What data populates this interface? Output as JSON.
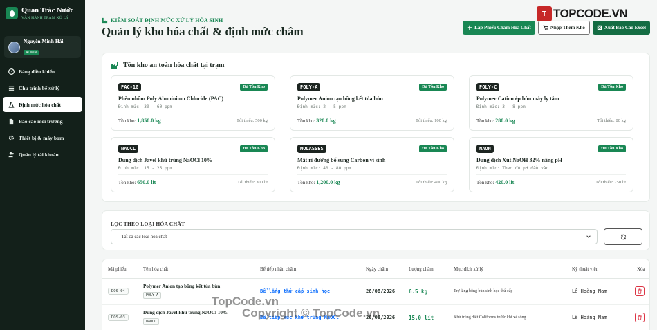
{
  "brand": {
    "title": "Quan Trắc Nước",
    "subtitle": "VẬN HÀNH TRẠM XỬ LÝ"
  },
  "user": {
    "name": "Nguyễn Minh Hải",
    "role": "ADMIN"
  },
  "nav": [
    {
      "label": "Bảng điều khiển",
      "icon": "gauge-icon"
    },
    {
      "label": "Chu trình bể xử lý",
      "icon": "list-icon"
    },
    {
      "label": "Định mức hóa chất",
      "icon": "flask-icon"
    },
    {
      "label": "Báo cáo môi trường",
      "icon": "document-icon"
    },
    {
      "label": "Thiết bị & máy bơm",
      "icon": "gear-icon"
    },
    {
      "label": "Quản lý tài khoản",
      "icon": "users-icon"
    }
  ],
  "header": {
    "eyebrow": "KIỂM SOÁT ĐỊNH MỨC XỬ LÝ HÓA SINH",
    "title": "Quản lý kho hóa chất & định mức châm",
    "actions": {
      "create": "Lập Phiếu Châm Hóa Chất",
      "import": "Nhập Thêm Kho",
      "export": "Xuất Báo Cáo Excel"
    }
  },
  "stock": {
    "title": "Tồn kho an toàn hóa chất tại trạm",
    "stock_label": "Tồn kho:",
    "min_label": "Tối thiểu:",
    "cards": [
      {
        "code": "PAC-10",
        "status": "Đủ Tồn Kho",
        "name": "Phèn nhôm Poly Aluminium Chloride (PAC)",
        "norm": "Định mức: 30 - 60 ppm",
        "stock": "1,850.0 kg",
        "min": "500 kg"
      },
      {
        "code": "POLY-A",
        "status": "Đủ Tồn Kho",
        "name": "Polymer Anion tạo bông kết tủa bùn",
        "norm": "Định mức: 2 - 5 ppm",
        "stock": "320.0 kg",
        "min": "100 kg"
      },
      {
        "code": "POLY-C",
        "status": "Đủ Tồn Kho",
        "name": "Polymer Cation ép bùn máy ly tâm",
        "norm": "Định mức: 3 - 8 ppm",
        "stock": "280.0 kg",
        "min": "80 kg"
      },
      {
        "code": "NAOCL",
        "status": "Đủ Tồn Kho",
        "name": "Dung dịch Javel khử trùng NaOCl 10%",
        "norm": "Định mức: 15 - 25 ppm",
        "stock": "650.0 lít",
        "min": "300 lít"
      },
      {
        "code": "MOLASSES",
        "status": "Đủ Tồn Kho",
        "name": "Mật rỉ đường bổ sung Carbon vi sinh",
        "norm": "Định mức: 40 - 80 ppm",
        "stock": "1,200.0 kg",
        "min": "400 kg"
      },
      {
        "code": "NAOH",
        "status": "Đủ Tồn Kho",
        "name": "Dung dịch Xút NaOH 32% nâng pH",
        "norm": "Định mức: Theo độ pH đầu vào",
        "stock": "420.0 lít",
        "min": "250 lít"
      }
    ]
  },
  "filter": {
    "label": "LỌC THEO LOẠI HÓA CHẤT",
    "selected": "-- Tất cả các loại hóa chất --"
  },
  "table": {
    "headers": [
      "Mã phiếu",
      "Tên hóa chất",
      "Bể tiếp nhận châm",
      "Ngày châm",
      "Lượng châm",
      "Mục đích xử lý",
      "Kỹ thuật viên",
      "Xóa"
    ],
    "rows": [
      {
        "id": "DOS-04",
        "name": "Polymer Anion tạo bông kết tủa bùn",
        "code": "POLY-A",
        "tank": "Bể lắng thứ cấp sinh học",
        "date": "26/08/2026",
        "amount": "6.5 kg",
        "purpose": "Trợ lắng bông bùn sinh học thứ cấp",
        "tech": "Lê Hoàng Nam"
      },
      {
        "id": "DOS-03",
        "name": "Dung dịch Javel khử trùng NaOCl 10%",
        "code": "NAOCL",
        "tank": "Bể tiếp xúc khử trùng NaOCl",
        "date": "26/08/2026",
        "amount": "15.0 lít",
        "purpose": "Khử trùng diệt Coliforms trước khi xả sông",
        "tech": "Lê Hoàng Nam"
      }
    ]
  },
  "watermark": {
    "logo_mark": "T",
    "logo_text": "TOPCODE.VN",
    "line1": "TopCode.vn",
    "line2": "Copyright © TopCode.vn"
  },
  "colors": {
    "accent": "#198754",
    "sidebar": "#13201a",
    "link": "#0d6efd",
    "danger": "#dc3545"
  }
}
